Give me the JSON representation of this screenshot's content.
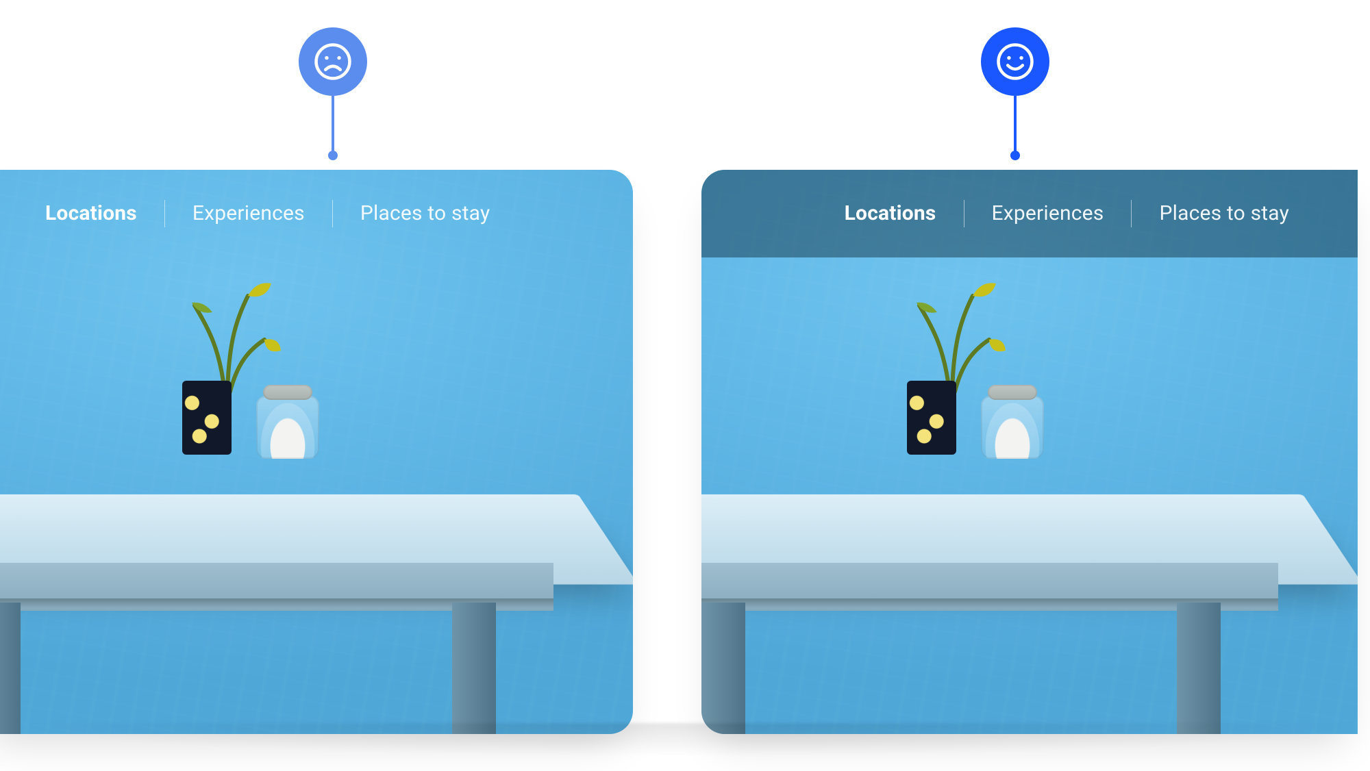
{
  "badges": {
    "bad": {
      "mood": "sad",
      "color": "#5b8def"
    },
    "good": {
      "mood": "happy",
      "color": "#1a57ff"
    }
  },
  "nav": {
    "items": [
      {
        "label": "Locations",
        "active": true
      },
      {
        "label": "Experiences",
        "active": false
      },
      {
        "label": "Places to stay",
        "active": false
      }
    ]
  },
  "comparison": {
    "left": {
      "has_nav_backdrop": false,
      "verdict": "bad"
    },
    "right": {
      "has_nav_backdrop": true,
      "verdict": "good"
    }
  }
}
